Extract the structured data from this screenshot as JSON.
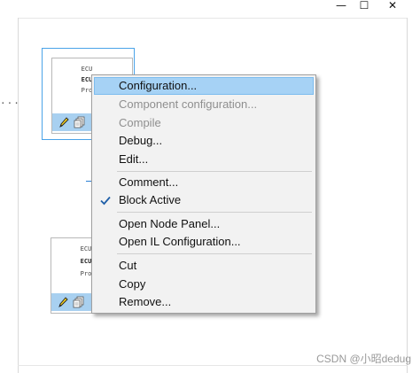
{
  "window": {
    "minimize_glyph": "—",
    "maximize_glyph": "☐",
    "close_glyph": "✕"
  },
  "canvas": {
    "ellipsis": "...",
    "nodes": [
      {
        "line1": "ECU",
        "line2": "ECU",
        "line3": "Pro",
        "selected": true
      },
      {
        "line1": "ECU",
        "line2": "ECU",
        "line3": "Pro",
        "selected": false
      }
    ],
    "node_icons": [
      "pencil-icon",
      "document-stack-icon"
    ]
  },
  "context_menu": {
    "items": [
      {
        "label": "Configuration...",
        "state": "highlighted"
      },
      {
        "label": "Component configuration...",
        "state": "disabled"
      },
      {
        "label": "Compile",
        "state": "disabled"
      },
      {
        "label": "Debug...",
        "state": "enabled"
      },
      {
        "label": "Edit...",
        "state": "enabled"
      },
      {
        "label": "Comment...",
        "state": "enabled"
      },
      {
        "label": "Block Active",
        "state": "checked"
      },
      {
        "label": "Open Node Panel...",
        "state": "enabled"
      },
      {
        "label": "Open IL Configuration...",
        "state": "enabled"
      },
      {
        "label": "Cut",
        "state": "enabled"
      },
      {
        "label": "Copy",
        "state": "enabled"
      },
      {
        "label": "Remove...",
        "state": "enabled"
      }
    ],
    "check_icon": "checkmark-icon"
  },
  "watermark": "CSDN @小昭dedug",
  "colors": {
    "highlight": "#a6d2f5",
    "menu_bg": "#f2f2f2",
    "node_bar": "#a8d0f0",
    "selection_border": "#4aa3e8",
    "disabled_text": "#8f8f8f"
  }
}
